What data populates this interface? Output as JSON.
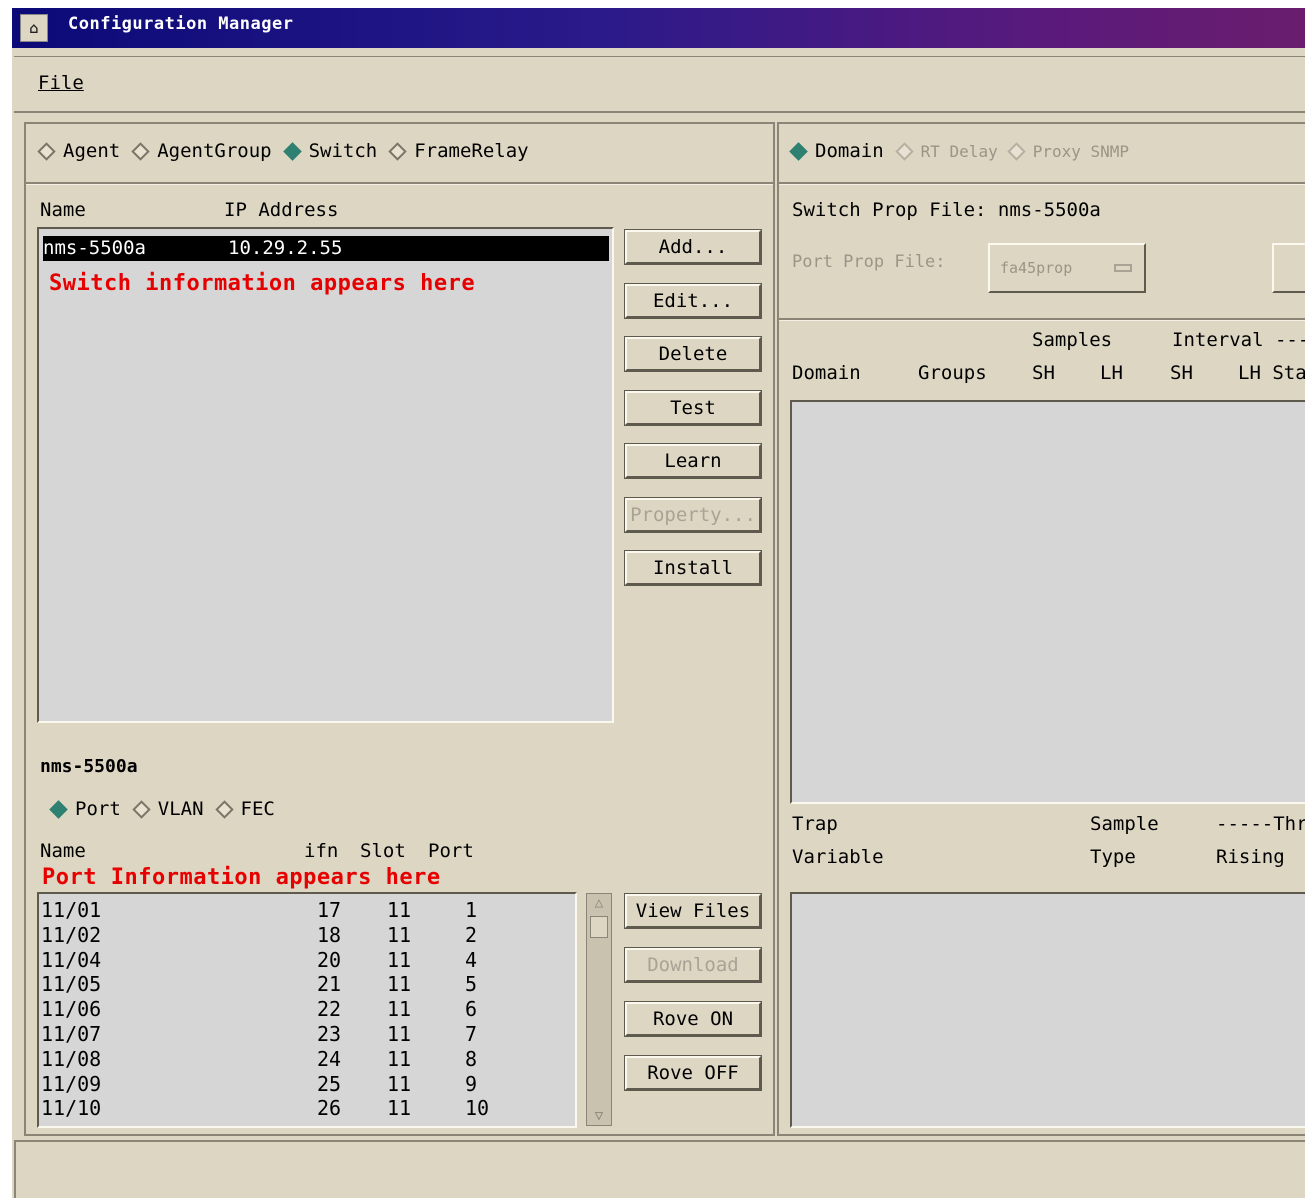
{
  "window": {
    "title": "Configuration Manager"
  },
  "menu": {
    "file_label": "File"
  },
  "left": {
    "type_radios": [
      {
        "label": "Agent",
        "selected": false
      },
      {
        "label": "AgentGroup",
        "selected": false
      },
      {
        "label": "Switch",
        "selected": true
      },
      {
        "label": "FrameRelay",
        "selected": false
      }
    ],
    "list_headers": {
      "name": "Name",
      "ip": "IP Address"
    },
    "selected_row": {
      "name": "nms-5500a",
      "ip": "10.29.2.55"
    },
    "switch_annotation": "Switch information appears here",
    "buttons": {
      "add": "Add...",
      "edit": "Edit...",
      "delete": "Delete",
      "test": "Test",
      "learn": "Learn",
      "property": "Property...",
      "install": "Install"
    },
    "device_title": "nms-5500a",
    "port_radios": [
      {
        "label": "Port",
        "selected": true
      },
      {
        "label": "VLAN",
        "selected": false
      },
      {
        "label": "FEC",
        "selected": false
      }
    ],
    "port_headers": {
      "name": "Name",
      "ifn": "ifn",
      "slot": "Slot",
      "port": "Port"
    },
    "port_annotation": "Port Information appears here",
    "ports": [
      {
        "name": "11/01",
        "ifn": "17",
        "slot": "11",
        "port": "1"
      },
      {
        "name": "11/02",
        "ifn": "18",
        "slot": "11",
        "port": "2"
      },
      {
        "name": "11/04",
        "ifn": "20",
        "slot": "11",
        "port": "4"
      },
      {
        "name": "11/05",
        "ifn": "21",
        "slot": "11",
        "port": "5"
      },
      {
        "name": "11/06",
        "ifn": "22",
        "slot": "11",
        "port": "6"
      },
      {
        "name": "11/07",
        "ifn": "23",
        "slot": "11",
        "port": "7"
      },
      {
        "name": "11/08",
        "ifn": "24",
        "slot": "11",
        "port": "8"
      },
      {
        "name": "11/09",
        "ifn": "25",
        "slot": "11",
        "port": "9"
      },
      {
        "name": "11/10",
        "ifn": "26",
        "slot": "11",
        "port": "10"
      }
    ],
    "port_buttons": {
      "view_files": "View Files",
      "download": "Download",
      "rove_on": "Rove ON",
      "rove_off": "Rove OFF"
    }
  },
  "right": {
    "radios": [
      {
        "label": "Domain",
        "selected": true,
        "enabled": true
      },
      {
        "label": "RT Delay",
        "selected": false,
        "enabled": false
      },
      {
        "label": "Proxy SNMP",
        "selected": false,
        "enabled": false
      }
    ],
    "switch_prop_file": "Switch Prop File: nms-5500a",
    "port_prop_label": "Port Prop File:",
    "port_prop_value": "fa45prop",
    "domain_headers": {
      "samples": "Samples",
      "interval": "Interval ---",
      "domain": "Domain",
      "groups": "Groups",
      "sh1": "SH",
      "lh1": "LH",
      "sh2": "SH",
      "lh_sta": "LH Sta"
    },
    "trap_headers": {
      "trap": "Trap",
      "variable": "Variable",
      "sample": "Sample",
      "type": "Type",
      "thr": "-----Thr",
      "rising": "Rising"
    }
  }
}
